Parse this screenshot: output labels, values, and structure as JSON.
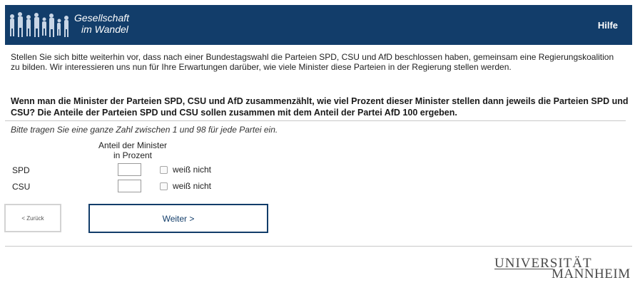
{
  "header": {
    "logo_line1": "Gesellschaft",
    "logo_line2": "im Wandel",
    "help_label": "Hilfe"
  },
  "intro_text": "Stellen Sie sich bitte weiterhin vor, dass nach einer Bundestagswahl die Parteien SPD, CSU und AfD beschlossen haben, gemeinsam eine Regierungskoalition zu bilden. Wir interessieren uns nun für Ihre Erwartungen darüber, wie viele Minister diese Parteien in der Regierung stellen werden.",
  "question_text": "Wenn man die Minister der Parteien SPD, CSU und AfD zusammenzählt, wie viel Prozent dieser Minister stellen dann jeweils die Parteien SPD und CSU? Die Anteile der Parteien SPD und CSU sollen zusammen mit dem Anteil der Partei AfD 100 ergeben.",
  "instruction_text": "Bitte tragen Sie eine ganze Zahl zwischen 1 und 98 für jede Partei ein.",
  "column_header_line1": "Anteil der Minister",
  "column_header_line2": "in Prozent",
  "rows": [
    {
      "label": "SPD",
      "value": "",
      "dont_know_label": "weiß nicht",
      "dont_know_checked": false
    },
    {
      "label": "CSU",
      "value": "",
      "dont_know_label": "weiß nicht",
      "dont_know_checked": false
    }
  ],
  "buttons": {
    "back_label": "< Zurück",
    "next_label": "Weiter >"
  },
  "footer": {
    "logo_line1": "UNIVERSITÄT",
    "logo_line2": "MANNHEIM"
  },
  "colors": {
    "header_bg": "#123d6a",
    "accent": "#123d6a"
  }
}
